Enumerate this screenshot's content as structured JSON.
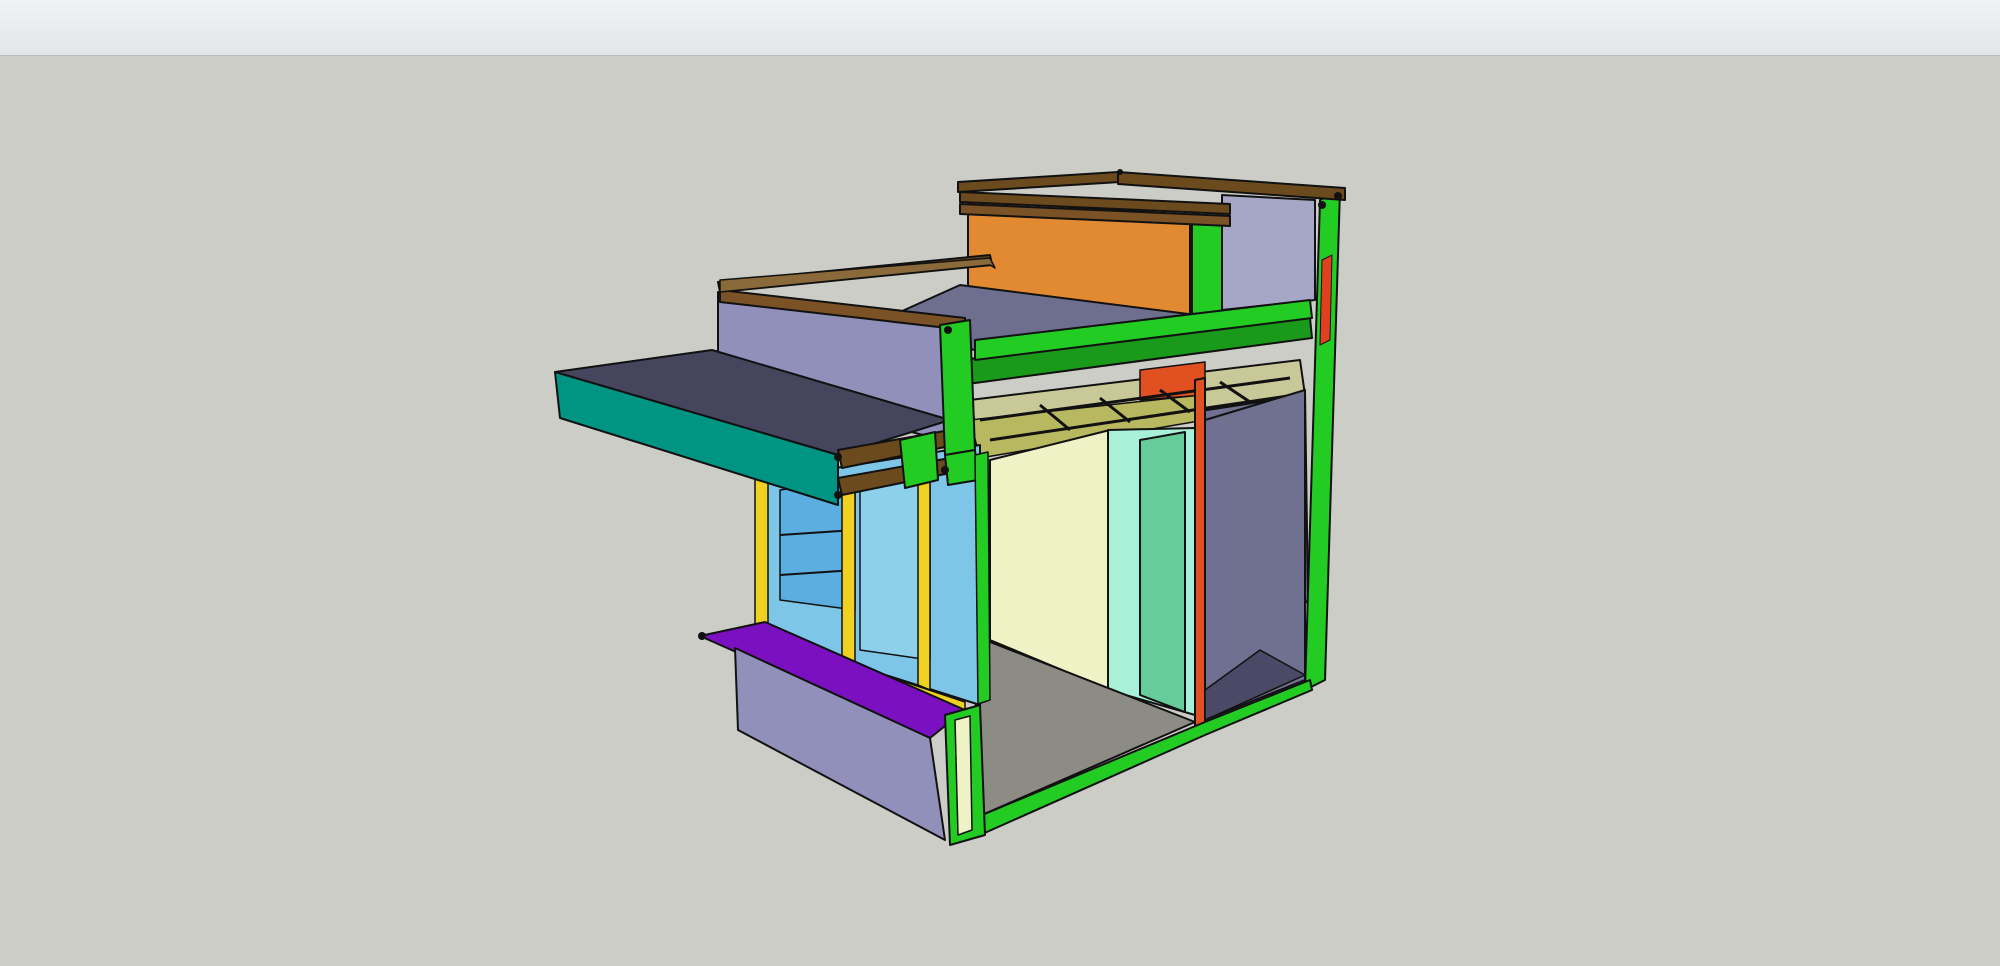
{
  "app": {
    "toolbar": {},
    "viewport": {
      "model": "building-section",
      "background": "#cdcdc8"
    }
  },
  "colors": {
    "roof_top": "#4a4a66",
    "fascia_teal": "#009482",
    "parapet_lavender": "#9090ba",
    "beam_brown": "#6b4a1e",
    "structure_green": "#22cc22",
    "wall_orange": "#e28a32",
    "glass_blue": "#7ec6e8",
    "mullion_yellow": "#f0d020",
    "sill_purple": "#7a10c0",
    "interior_wall": "#eef2c4",
    "floor_gray": "#8c8c84",
    "door_teal": "#66cc9a",
    "side_wall": "#707090"
  }
}
